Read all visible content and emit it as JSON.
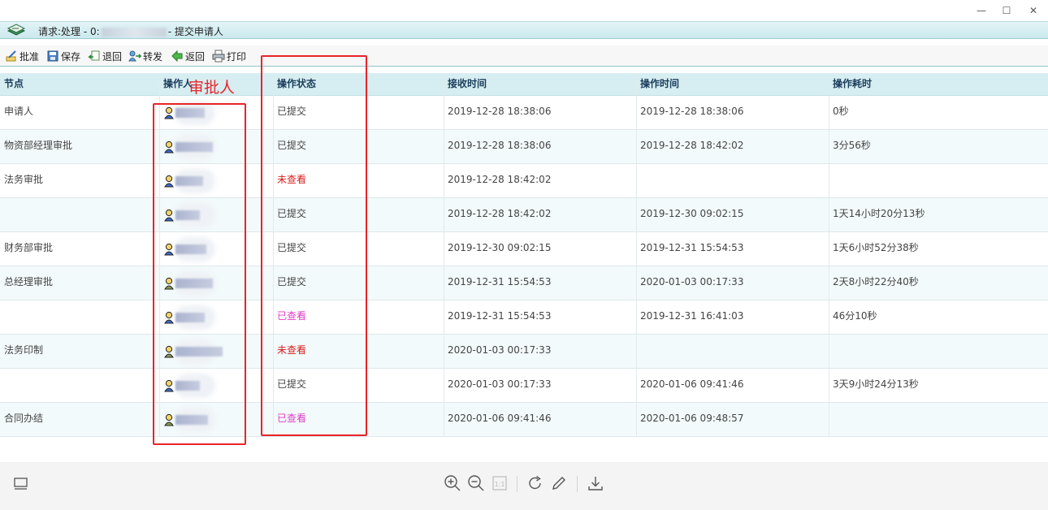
{
  "window": {
    "minimize": "—",
    "maximize": "☐",
    "close": "✕"
  },
  "title": {
    "prefix": "请求:处理 - 0:",
    "suffix": "- 提交申请人"
  },
  "toolbar": {
    "approve": "批准",
    "save": "保存",
    "return_back": "退回",
    "forward": "转发",
    "go_back": "返回",
    "print": "打印"
  },
  "columns": {
    "node": "节点",
    "operator": "操作人",
    "status": "操作状态",
    "receive_time": "接收时间",
    "operate_time": "操作时间",
    "duration": "操作耗时"
  },
  "annotation": {
    "label": "审批人"
  },
  "rows": [
    {
      "node": "申请人",
      "status": "已提交",
      "status_type": "submitted",
      "receive_time": "2019-12-28 18:38:06",
      "operate_time": "2019-12-28 18:38:06",
      "duration": "0秒"
    },
    {
      "node": "物资部经理审批",
      "status": "已提交",
      "status_type": "submitted",
      "receive_time": "2019-12-28 18:38:06",
      "operate_time": "2019-12-28 18:42:02",
      "duration": "3分56秒"
    },
    {
      "node": "法务审批",
      "status": "未查看",
      "status_type": "unviewed",
      "receive_time": "2019-12-28 18:42:02",
      "operate_time": "",
      "duration": ""
    },
    {
      "node": "",
      "status": "已提交",
      "status_type": "submitted",
      "receive_time": "2019-12-28 18:42:02",
      "operate_time": "2019-12-30 09:02:15",
      "duration": "1天14小时20分13秒"
    },
    {
      "node": "财务部审批",
      "status": "已提交",
      "status_type": "submitted",
      "receive_time": "2019-12-30 09:02:15",
      "operate_time": "2019-12-31 15:54:53",
      "duration": "1天6小时52分38秒"
    },
    {
      "node": "总经理审批",
      "status": "已提交",
      "status_type": "submitted",
      "receive_time": "2019-12-31 15:54:53",
      "operate_time": "2020-01-03 00:17:33",
      "duration": "2天8小时22分40秒"
    },
    {
      "node": "",
      "status": "已查看",
      "status_type": "viewed",
      "receive_time": "2019-12-31 15:54:53",
      "operate_time": "2019-12-31 16:41:03",
      "duration": "46分10秒"
    },
    {
      "node": "法务印制",
      "status": "未查看",
      "status_type": "unviewed",
      "receive_time": "2020-01-03 00:17:33",
      "operate_time": "",
      "duration": ""
    },
    {
      "node": "",
      "status": "已提交",
      "status_type": "submitted",
      "receive_time": "2020-01-03 00:17:33",
      "operate_time": "2020-01-06 09:41:46",
      "duration": "3天9小时24分13秒"
    },
    {
      "node": "合同办结",
      "status": "已查看",
      "status_type": "viewed",
      "receive_time": "2020-01-06 09:41:46",
      "operate_time": "2020-01-06 09:48:57",
      "duration": ""
    }
  ],
  "bottom_bar": {
    "icons": [
      "fit-screen-icon",
      "zoom-in-icon",
      "zoom-out-icon",
      "actual-size-icon",
      "rotate-icon",
      "edit-icon",
      "download-icon"
    ],
    "actual_size_label": "1:1"
  },
  "colors": {
    "status_submitted": "#444444",
    "status_unviewed": "#d81e1e",
    "status_viewed": "#e03cc8",
    "annotation": "#e8242a",
    "header_bg": "#d6eef1"
  }
}
